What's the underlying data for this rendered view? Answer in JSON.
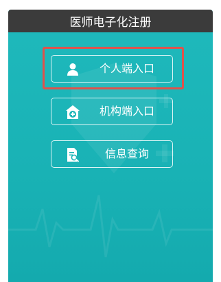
{
  "header": {
    "title": "医师电子化注册"
  },
  "buttons": [
    {
      "label": "个人端入口",
      "icon": "person-icon"
    },
    {
      "label": "机构端入口",
      "icon": "hospital-icon"
    },
    {
      "label": "信息查询",
      "icon": "document-search-icon"
    }
  ],
  "colors": {
    "panel": "#1cb5b8",
    "header": "#3b3b3b",
    "highlight": "#e0524b"
  }
}
